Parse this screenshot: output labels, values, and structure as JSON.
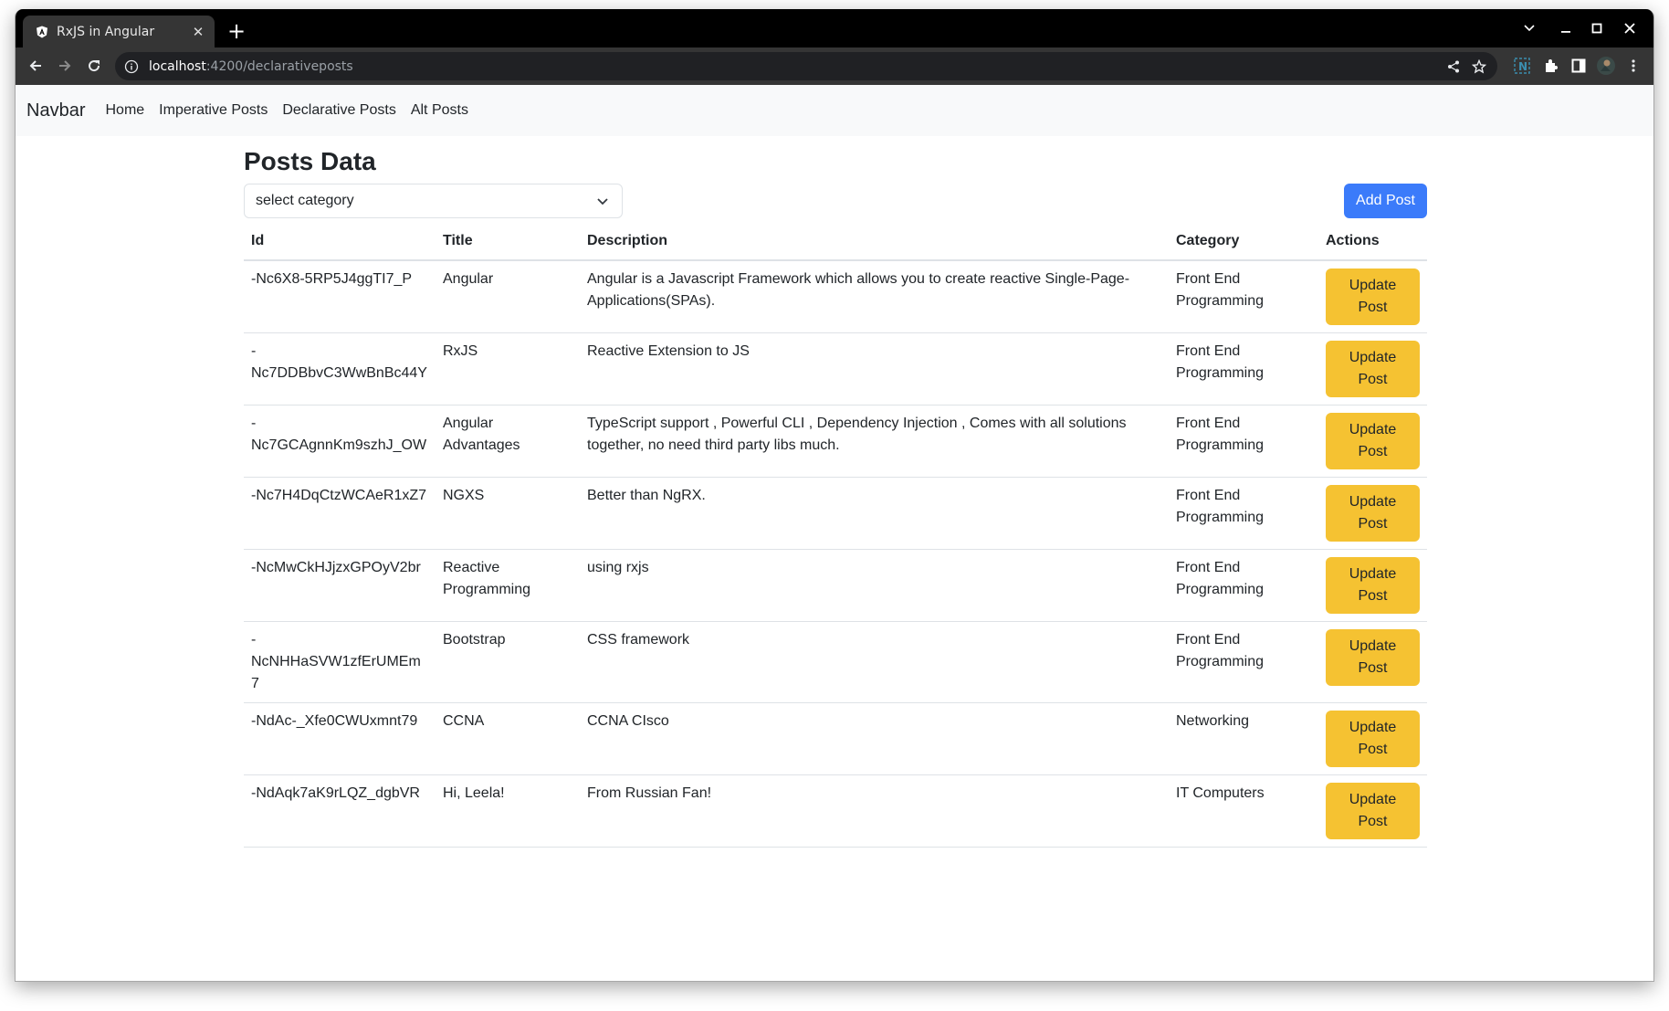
{
  "browser": {
    "tab_title": "RxJS in Angular",
    "url_host": "localhost",
    "url_path": ":4200/declarativeposts"
  },
  "navbar": {
    "brand": "Navbar",
    "links": [
      "Home",
      "Imperative Posts",
      "Declarative Posts",
      "Alt Posts"
    ]
  },
  "main": {
    "heading": "Posts Data",
    "category_select": {
      "value": "select category"
    },
    "add_button": "Add Post",
    "columns": [
      "Id",
      "Title",
      "Description",
      "Category",
      "Actions"
    ],
    "rows": [
      {
        "id": "-Nc6X8-5RP5J4ggTI7_P",
        "title": "Angular",
        "description": "Angular is a Javascript Framework which allows you to create reactive Single-Page-Applications(SPAs).",
        "category": "Front End Programming",
        "action": "Update Post"
      },
      {
        "id": "-Nc7DDBbvC3WwBnBc44Y",
        "title": "RxJS",
        "description": "Reactive Extension to JS",
        "category": "Front End Programming",
        "action": "Update Post"
      },
      {
        "id": "-Nc7GCAgnnKm9szhJ_OW",
        "title": "Angular Advantages",
        "description": "TypeScript support , Powerful CLI , Dependency Injection , Comes with all solutions together, no need third party libs much.",
        "category": "Front End Programming",
        "action": "Update Post"
      },
      {
        "id": "-Nc7H4DqCtzWCAeR1xZ7",
        "title": "NGXS",
        "description": "Better than NgRX.",
        "category": "Front End Programming",
        "action": "Update Post"
      },
      {
        "id": "-NcMwCkHJjzxGPOyV2br",
        "title": "Reactive Programming",
        "description": "using rxjs",
        "category": "Front End Programming",
        "action": "Update Post"
      },
      {
        "id": "-NcNHHaSVW1zfErUMEm7",
        "title": "Bootstrap",
        "description": "CSS framework",
        "category": "Front End Programming",
        "action": "Update Post"
      },
      {
        "id": "-NdAc-_Xfe0CWUxmnt79",
        "title": "CCNA",
        "description": "CCNA CIsco",
        "category": "Networking",
        "action": "Update Post"
      },
      {
        "id": "-NdAqk7aK9rLQZ_dgbVR",
        "title": "Hi, Leela!",
        "description": "From Russian Fan!",
        "category": "IT Computers",
        "action": "Update Post"
      }
    ]
  },
  "colors": {
    "primary": "#3b7bfa",
    "warning": "#f5c232",
    "navbar_bg": "#f8f9fa"
  }
}
